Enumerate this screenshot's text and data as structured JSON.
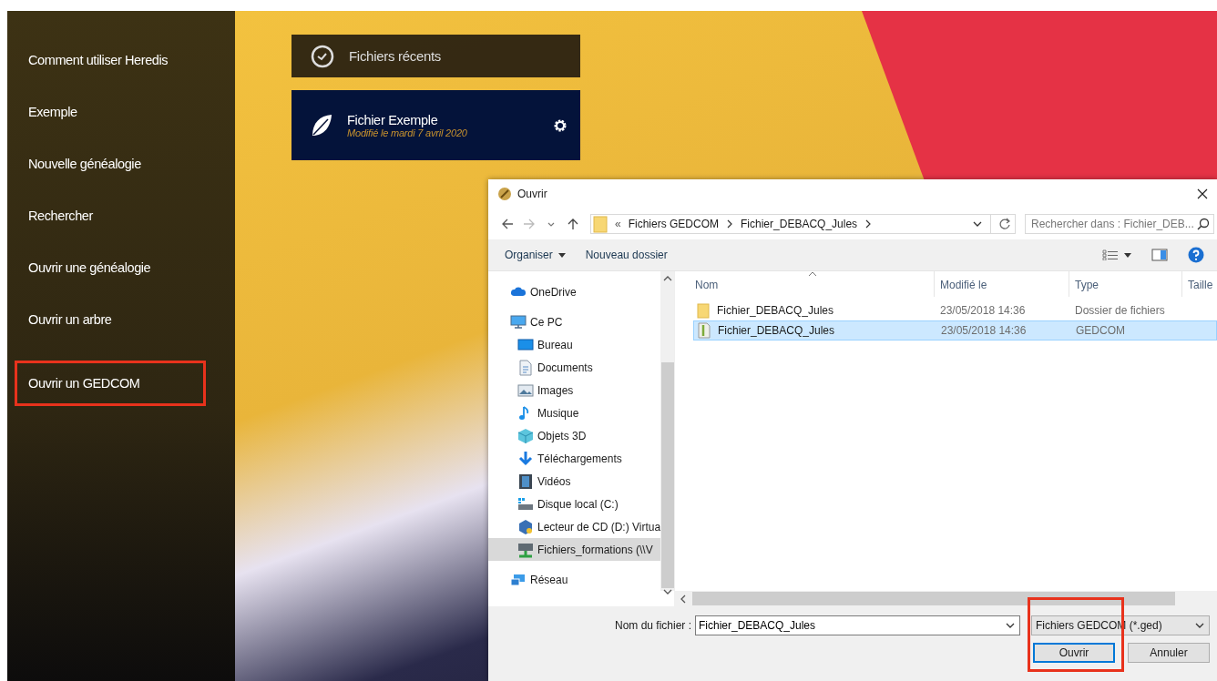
{
  "sidebar": {
    "items": [
      {
        "label": "Comment utiliser Heredis",
        "highlighted": false
      },
      {
        "label": "Exemple",
        "highlighted": false
      },
      {
        "label": "Nouvelle généalogie",
        "highlighted": false
      },
      {
        "label": "Rechercher",
        "highlighted": false
      },
      {
        "label": "Ouvrir une généalogie",
        "highlighted": false
      },
      {
        "label": "Ouvrir un arbre",
        "highlighted": false
      },
      {
        "label": "Ouvrir un GEDCOM",
        "highlighted": true
      }
    ]
  },
  "recent": {
    "title": "Fichiers récents",
    "files": [
      {
        "name": "Fichier Exemple",
        "modified": "Modifié le mardi 7 avril 2020"
      }
    ]
  },
  "dialog": {
    "title": "Ouvrir",
    "overflow": "«",
    "breadcrumb": [
      "Fichiers GEDCOM",
      "Fichier_DEBACQ_Jules"
    ],
    "search": {
      "placeholder": "Rechercher dans : Fichier_DEB..."
    },
    "toolbar": [
      {
        "label": "Organiser",
        "kind": "menu"
      },
      {
        "label": "Nouveau dossier",
        "kind": "button"
      }
    ],
    "nav": [
      {
        "label": "OneDrive",
        "kind": "cloud",
        "selected": false
      },
      {
        "label": "Ce PC",
        "kind": "pc",
        "selected": false,
        "children": [
          {
            "label": "Bureau",
            "kind": "desktop",
            "selected": false
          },
          {
            "label": "Documents",
            "kind": "documents",
            "selected": false
          },
          {
            "label": "Images",
            "kind": "images",
            "selected": false
          },
          {
            "label": "Musique",
            "kind": "music",
            "selected": false
          },
          {
            "label": "Objets 3D",
            "kind": "cube",
            "selected": false
          },
          {
            "label": "Téléchargements",
            "kind": "download",
            "selected": false
          },
          {
            "label": "Vidéos",
            "kind": "video",
            "selected": false
          },
          {
            "label": "Disque local (C:)",
            "kind": "drive",
            "selected": false
          },
          {
            "label": "Lecteur de CD (D:) Virtua",
            "kind": "cd",
            "selected": false
          },
          {
            "label": "Fichiers_formations (\\\\V",
            "kind": "netdrive",
            "selected": true
          }
        ]
      },
      {
        "label": "Réseau",
        "kind": "network",
        "selected": false
      }
    ],
    "columns": [
      "Nom",
      "Modifié le",
      "Type",
      "Taille"
    ],
    "rows": [
      {
        "kind": "folder",
        "name": "Fichier_DEBACQ_Jules",
        "modified": "23/05/2018 14:36",
        "type": "Dossier de fichiers",
        "selected": false
      },
      {
        "kind": "file",
        "name": "Fichier_DEBACQ_Jules",
        "modified": "23/05/2018 14:36",
        "type": "GEDCOM",
        "selected": true
      }
    ],
    "filename_label": "Nom du fichier :",
    "filename": "Fichier_DEBACQ_Jules",
    "filter": "Fichiers GEDCOM (*.ged)",
    "buttons": [
      {
        "label": "Ouvrir",
        "default": true,
        "highlighted": true
      },
      {
        "label": "Annuler",
        "default": false,
        "highlighted": false
      }
    ]
  }
}
